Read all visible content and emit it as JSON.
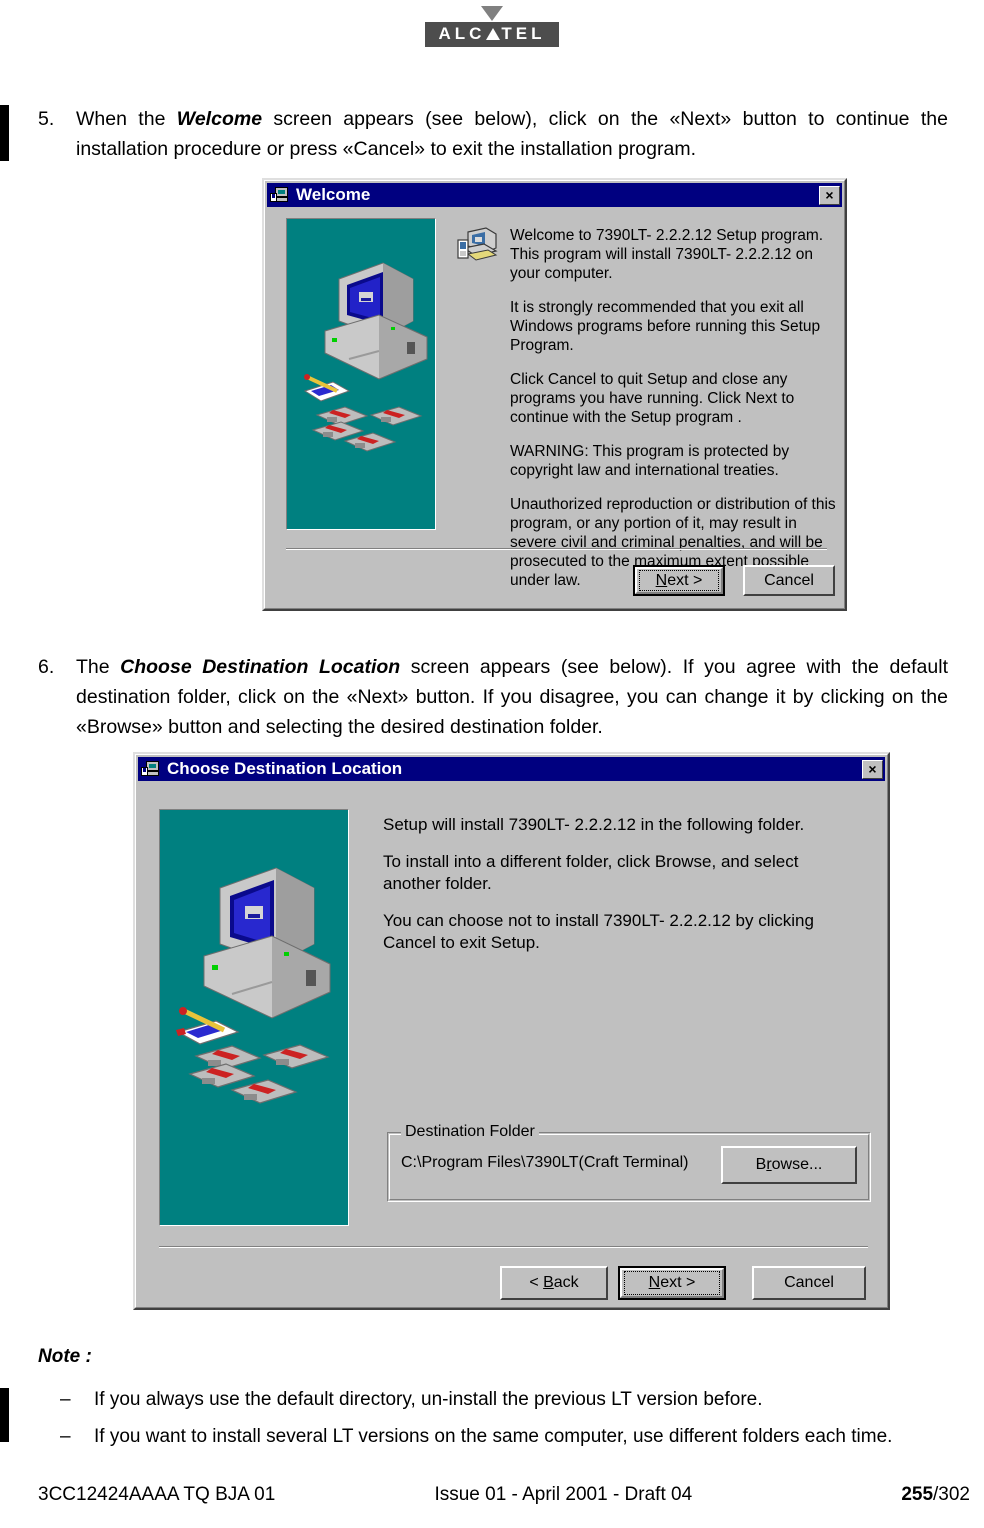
{
  "logo": {
    "text_before": "ALC",
    "text_after": "TEL",
    "alt": "Alcatel logo"
  },
  "steps": [
    {
      "number": "5.",
      "segments": [
        {
          "text": "When the ",
          "style": "normal"
        },
        {
          "text": "Welcome",
          "style": "bolditalic"
        },
        {
          "text": " screen appears (see below), click on the «Next» button to continue the installation procedure or press «Cancel» to exit the installation program.",
          "style": "normal"
        }
      ],
      "plain": "When the Welcome screen appears (see below), click on the «Next» button to continue the installation procedure or press «Cancel» to exit the installation program."
    },
    {
      "number": "6.",
      "segments": [
        {
          "text": "The ",
          "style": "normal"
        },
        {
          "text": "Choose Destination Location",
          "style": "bolditalic"
        },
        {
          "text": " screen appears (see below). If you agree with the default destination folder, click on the «Next» button. If you disagree, you can change it by clicking on the «Browse» button and selecting the desired destination folder.",
          "style": "normal"
        }
      ],
      "plain": "The Choose Destination Location screen appears (see below). If you agree with the default destination folder, click on the «Next» button. If you disagree, you can change it by clicking on the «Browse» button and selecting the desired destination folder."
    }
  ],
  "dialog_welcome": {
    "title": "Welcome",
    "close_label": "×",
    "paragraphs": [
      "Welcome to 7390LT- 2.2.2.12 Setup program. This program will install 7390LT- 2.2.2.12 on your computer.",
      "It is strongly recommended that you exit all Windows programs before running this Setup Program.",
      "Click Cancel to quit Setup and close any programs you have running.  Click Next to continue with the Setup program .",
      "WARNING: This program is protected by copyright law and international treaties.",
      "Unauthorized reproduction or distribution of this program, or any portion of it, may result in severe civil and criminal penalties, and will be prosecuted to the maximum extent possible under law."
    ],
    "buttons": {
      "next": "Next >",
      "next_mnemonic": "N",
      "cancel": "Cancel"
    }
  },
  "dialog_destination": {
    "title": "Choose Destination Location",
    "close_label": "×",
    "paragraphs": [
      "Setup will install 7390LT- 2.2.2.12 in the following folder.",
      "To install into a different folder, click Browse, and select another folder.",
      "You can choose not to install 7390LT- 2.2.2.12 by clicking Cancel to exit Setup."
    ],
    "group": {
      "title": "Destination Folder",
      "path": "C:\\Program Files\\7390LT(Craft Terminal)",
      "browse_label": "Browse...",
      "browse_mnemonic": "r"
    },
    "buttons": {
      "back": "< Back",
      "back_mnemonic": "B",
      "next": "Next >",
      "next_mnemonic": "N",
      "cancel": "Cancel"
    }
  },
  "note": {
    "label": "Note :",
    "dash": "–",
    "items": [
      "If you always use  the default directory, un-install the previous LT version before.",
      "If you want to install several LT versions on the same computer, use different folders each time."
    ]
  },
  "footer": {
    "left": "3CC12424AAAA TQ BJA 01",
    "center": "Issue 01 - April 2001 - Draft 04",
    "page": "255",
    "page_sep": "/302"
  },
  "colors": {
    "titlebar": "#000080",
    "dialog_face": "#c0c0c0",
    "illustration_bg": "#008080",
    "logo_box": "#4d4d4d"
  }
}
